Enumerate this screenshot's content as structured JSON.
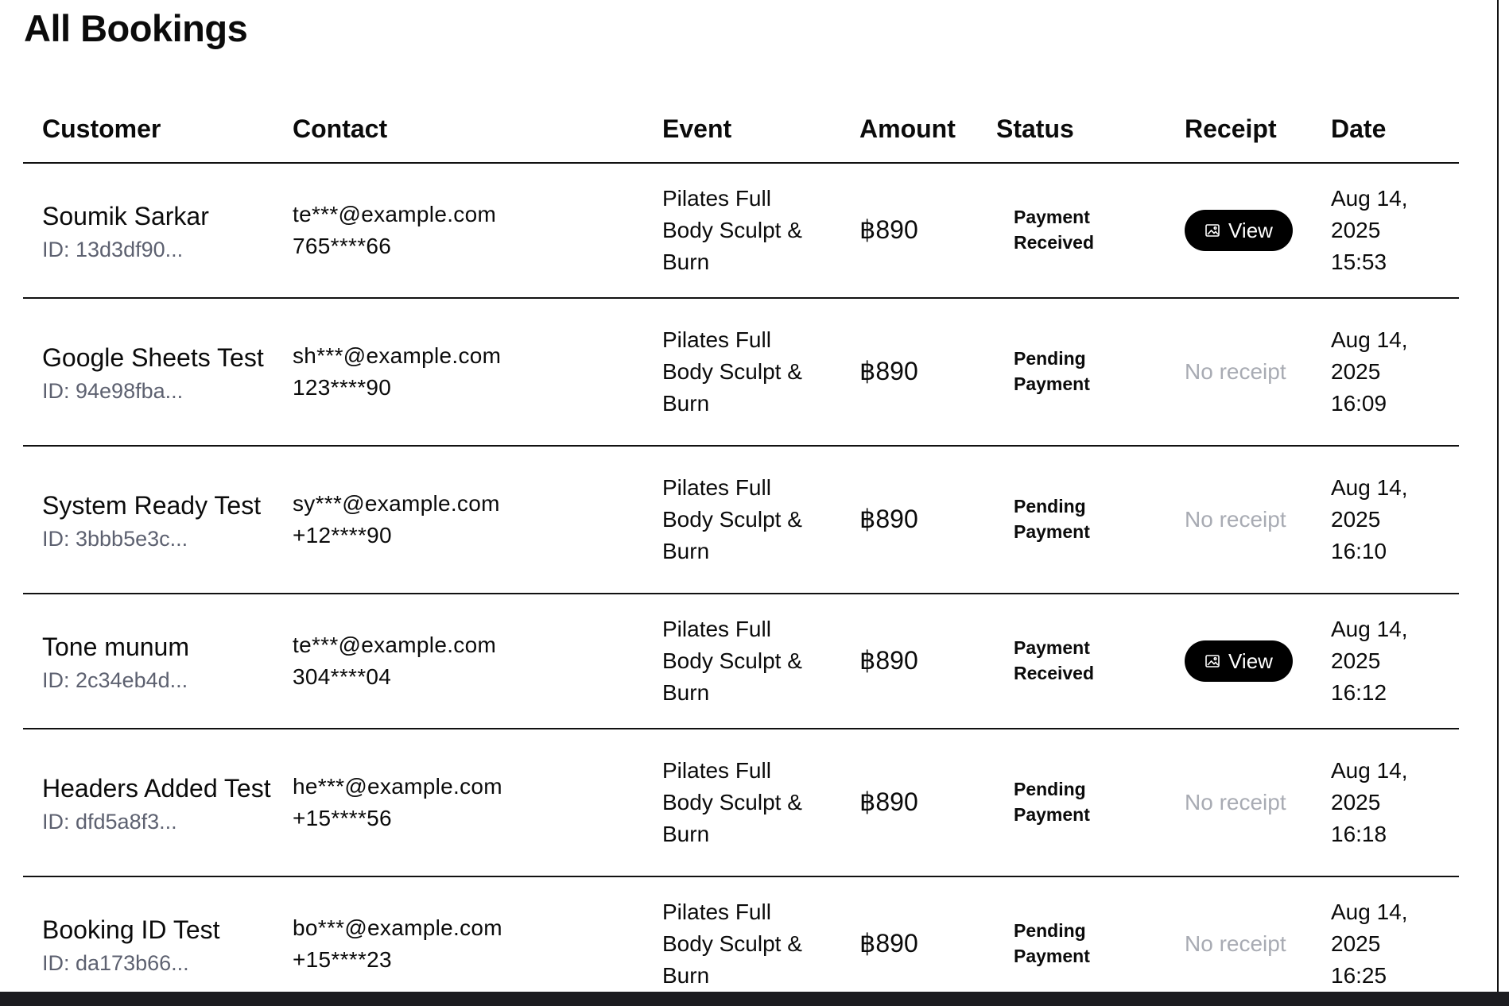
{
  "page_title": "All Bookings",
  "columns": [
    "Customer",
    "Contact",
    "Event",
    "Amount",
    "Status",
    "Receipt",
    "Date"
  ],
  "rows": [
    {
      "name": "Soumik Sarkar",
      "id": "ID: 13d3df90...",
      "email": "te***@example.com",
      "phone": "765****66",
      "event": [
        "Pilates Full",
        "Body Sculpt &",
        "Burn"
      ],
      "amount": "฿890",
      "status": [
        "Payment",
        "Received"
      ],
      "receipt": {
        "has_receipt": true,
        "label": "View",
        "icon": "image-icon"
      },
      "date": [
        "Aug 14,",
        "2025",
        "15:53"
      ]
    },
    {
      "name": "Google Sheets Test",
      "id": "ID: 94e98fba...",
      "email": "sh***@example.com",
      "phone": "123****90",
      "event": [
        "Pilates Full",
        "Body Sculpt &",
        "Burn"
      ],
      "amount": "฿890",
      "status": [
        "Pending",
        "Payment"
      ],
      "receipt": {
        "has_receipt": false,
        "label": "No receipt"
      },
      "date": [
        "Aug 14,",
        "2025",
        "16:09"
      ]
    },
    {
      "name": "System Ready Test",
      "id": "ID: 3bbb5e3c...",
      "email": "sy***@example.com",
      "phone": "+12****90",
      "event": [
        "Pilates Full",
        "Body Sculpt &",
        "Burn"
      ],
      "amount": "฿890",
      "status": [
        "Pending",
        "Payment"
      ],
      "receipt": {
        "has_receipt": false,
        "label": "No receipt"
      },
      "date": [
        "Aug 14,",
        "2025",
        "16:10"
      ]
    },
    {
      "name": "Tone munum",
      "id": "ID: 2c34eb4d...",
      "email": "te***@example.com",
      "phone": "304****04",
      "event": [
        "Pilates Full",
        "Body Sculpt &",
        "Burn"
      ],
      "amount": "฿890",
      "status": [
        "Payment",
        "Received"
      ],
      "receipt": {
        "has_receipt": true,
        "label": "View",
        "icon": "image-icon"
      },
      "date": [
        "Aug 14,",
        "2025",
        "16:12"
      ]
    },
    {
      "name": "Headers Added Test",
      "id": "ID: dfd5a8f3...",
      "email": "he***@example.com",
      "phone": "+15****56",
      "event": [
        "Pilates Full",
        "Body Sculpt &",
        "Burn"
      ],
      "amount": "฿890",
      "status": [
        "Pending",
        "Payment"
      ],
      "receipt": {
        "has_receipt": false,
        "label": "No receipt"
      },
      "date": [
        "Aug 14,",
        "2025",
        "16:18"
      ]
    },
    {
      "name": "Booking ID Test",
      "id": "ID: da173b66...",
      "email": "bo***@example.com",
      "phone": "+15****23",
      "event": [
        "Pilates Full",
        "Body Sculpt &",
        "Burn"
      ],
      "amount": "฿890",
      "status": [
        "Pending",
        "Payment"
      ],
      "receipt": {
        "has_receipt": false,
        "label": "No receipt"
      },
      "date": [
        "Aug 14,",
        "2025",
        "16:25"
      ]
    }
  ]
}
